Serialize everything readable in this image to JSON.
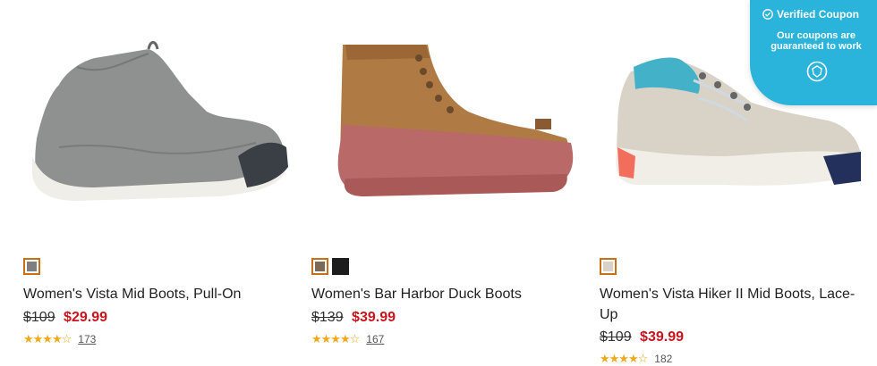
{
  "coupon": {
    "title": "Verified Coupon",
    "subtitle": "Our coupons are guaranteed to work"
  },
  "products": [
    {
      "title": "Women's Vista Mid Boots, Pull-On",
      "price_old": "$109",
      "price_new": "$29.99",
      "rating": "★★★★☆",
      "review_count": "173",
      "swatches": [
        "#7f7f7f"
      ]
    },
    {
      "title": "Women's Bar Harbor Duck Boots",
      "price_old": "$139",
      "price_new": "$39.99",
      "rating": "★★★★☆",
      "review_count": "167",
      "swatches": [
        "#7a6a58",
        "#1d1d1d"
      ]
    },
    {
      "title": "Women's Vista Hiker II Mid Boots, Lace-Up",
      "price_old": "$109",
      "price_new": "$39.99",
      "rating": "★★★★☆",
      "review_count": "182",
      "swatches": [
        "#d8d2c8"
      ]
    }
  ]
}
